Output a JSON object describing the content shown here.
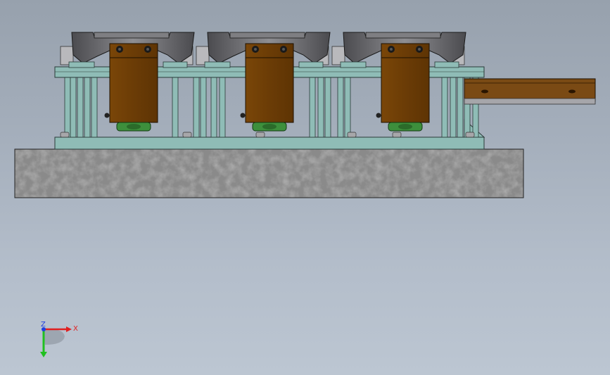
{
  "viewport": {
    "background_top": "#97a1ad",
    "background_bottom": "#bcc6d2"
  },
  "model": {
    "stations": 3,
    "colors": {
      "frame": "#8fbcb6",
      "frame_edge": "#2a3a38",
      "bracket": "#6b3c06",
      "bracket_edge": "#1e1000",
      "bolt": "#1a1a1a",
      "base_pad": "#3d8f3c",
      "chute": "#5a5a5e",
      "chute_light": "#9a9a9e",
      "concrete": "#8a8a8a",
      "conveyor": "#7a4a14"
    }
  },
  "triad": {
    "x_label": "X",
    "z_label": "Z",
    "x_color": "#e02020",
    "y_color": "#20c020",
    "z_color": "#2040e0"
  }
}
